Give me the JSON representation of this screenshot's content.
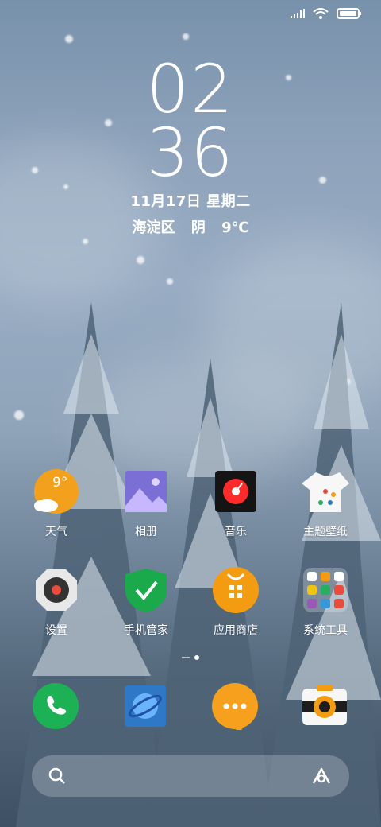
{
  "status_bar": {
    "icons": [
      "signal-icon",
      "wifi-icon",
      "battery-icon"
    ]
  },
  "clock": {
    "hours": "02",
    "minutes": "36"
  },
  "date": "11月17日 星期二",
  "weather": {
    "district": "海淀区",
    "condition": "阴",
    "temperature": "9℃"
  },
  "apps": [
    {
      "label": "天气",
      "icon": "weather-icon",
      "badge": "9°"
    },
    {
      "label": "相册",
      "icon": "gallery-icon"
    },
    {
      "label": "音乐",
      "icon": "music-icon"
    },
    {
      "label": "主题壁纸",
      "icon": "themes-icon"
    },
    {
      "label": "设置",
      "icon": "settings-icon"
    },
    {
      "label": "手机管家",
      "icon": "security-icon"
    },
    {
      "label": "应用商店",
      "icon": "app-store-icon"
    },
    {
      "label": "系统工具",
      "icon": "tools-folder-icon"
    }
  ],
  "dock": [
    {
      "name": "phone",
      "icon": "phone-icon"
    },
    {
      "name": "browser",
      "icon": "browser-icon"
    },
    {
      "name": "messages",
      "icon": "messages-icon"
    },
    {
      "name": "camera",
      "icon": "camera-icon"
    }
  ],
  "search_bar": {
    "left_icon": "search-icon",
    "right_icon": "assistant-icon"
  },
  "colors": {
    "weather_orange": "#f3a11c",
    "gallery_purple": "#7b6fd6",
    "security_green": "#1aa94b",
    "store_orange": "#f39c12",
    "phone_green": "#1db155",
    "browser_blue": "#2f78c8",
    "messages_orange": "#f7a01d"
  }
}
